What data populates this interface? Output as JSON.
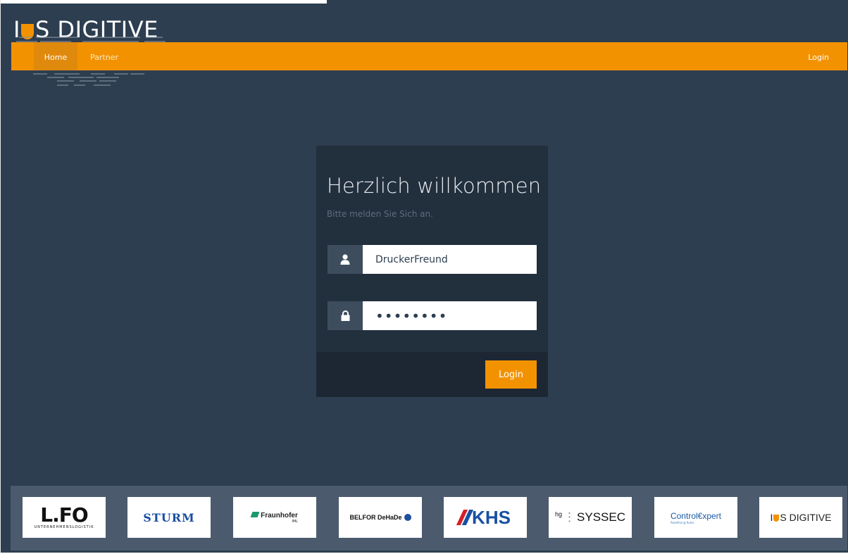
{
  "header": {
    "logo_text_pre": "I",
    "logo_text_post": "S DIGITIVE"
  },
  "nav": {
    "home": "Home",
    "partner": "Partner",
    "login": "Login"
  },
  "login_card": {
    "title": "Herzlich willkommen",
    "subtitle": "Bitte melden Sie Sich an.",
    "username_value": "DruckerFreund",
    "password_value": "••••••••",
    "submit_label": "Login"
  },
  "partners": {
    "lfo": "L.FO",
    "lfo_sub": "UNTERNEHMENSLOGISTIK",
    "sturm": "STURM",
    "fraunhofer": "Fraunhofer",
    "fraunhofer_sub": "IML",
    "belfor": "BELFOR DeHaDe",
    "khs": "KHS",
    "syssec_prefix": "hg",
    "syssec": "SYSSEC",
    "control_expert": "Control€xpert",
    "control_expert_sub": "Redefining Rules.",
    "its_pre": "I",
    "its_post": "S DIGITIVE"
  },
  "colors": {
    "background": "#2d3e50",
    "accent": "#f39200",
    "card": "#222f3d",
    "card_footer": "#1c2733",
    "partner_bar": "#4b5b6d"
  },
  "icons": {
    "username": "user-icon",
    "password": "lock-icon"
  }
}
